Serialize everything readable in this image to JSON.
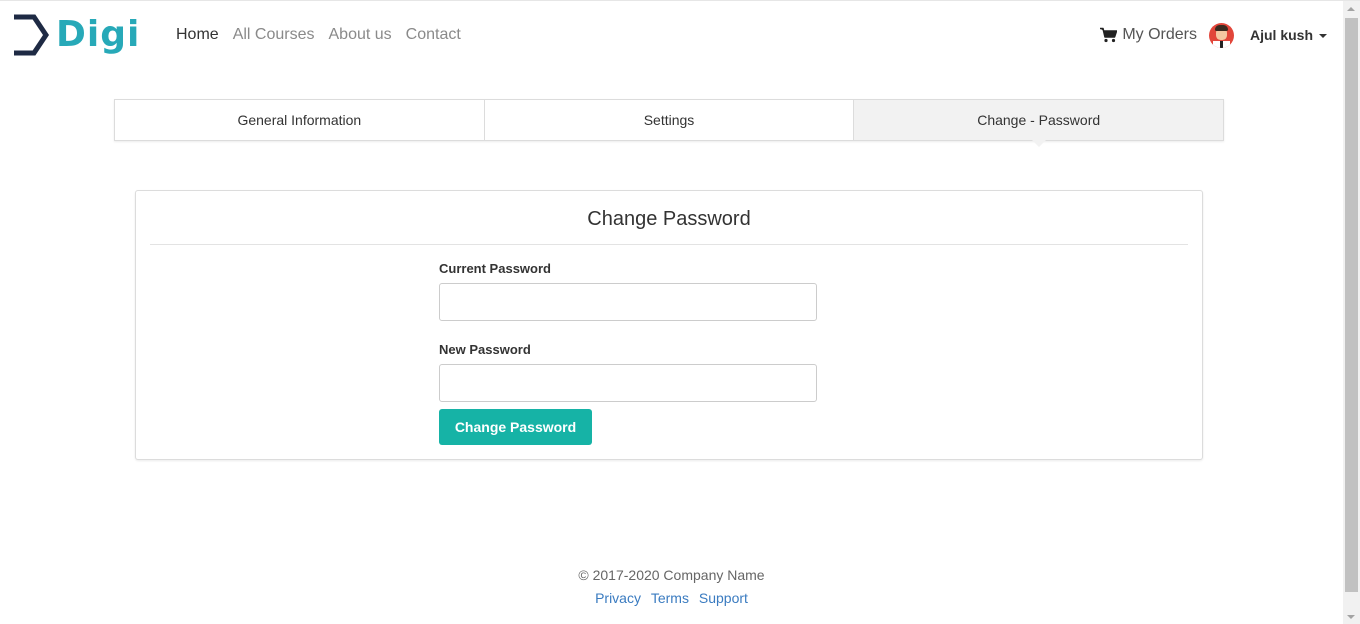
{
  "brand": {
    "name": "Digi",
    "color": "#27a9b8"
  },
  "nav": {
    "links": [
      "Home",
      "All Courses",
      "About us",
      "Contact"
    ],
    "active": "Home"
  },
  "user_area": {
    "orders_label": "My Orders",
    "orders_icon": "cart-icon",
    "user_name": "Ajul kush"
  },
  "tabs": [
    {
      "label": "General Information"
    },
    {
      "label": "Settings"
    },
    {
      "label": "Change - Password",
      "active": true
    }
  ],
  "form": {
    "title": "Change Password",
    "current_password_label": "Current Password",
    "current_password_value": "",
    "new_password_label": "New Password",
    "new_password_value": "",
    "submit_label": "Change Password",
    "button_color": "#16b3a6"
  },
  "footer": {
    "copyright": "© 2017-2020 Company Name",
    "links": [
      "Privacy",
      "Terms",
      "Support"
    ],
    "link_color": "#3a7bc0"
  }
}
